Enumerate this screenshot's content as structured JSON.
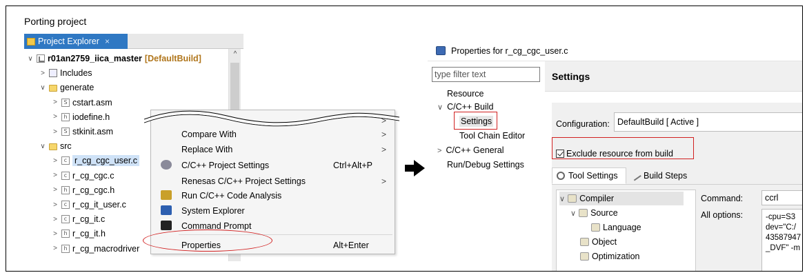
{
  "frame_title": "Porting project",
  "project_explorer": {
    "tab_label": "Project Explorer",
    "tab_close": "×",
    "tree": [
      {
        "label": "r01an2759_iica_master",
        "suffix": "[DefaultBuild]",
        "arrow": "∨",
        "icon": "project-icon",
        "indent": 0
      },
      {
        "label": "Includes",
        "arrow": ">",
        "icon": "includes-icon",
        "indent": 1
      },
      {
        "label": "generate",
        "arrow": "∨",
        "icon": "folder-icon",
        "indent": 1
      },
      {
        "label": "cstart.asm",
        "arrow": ">",
        "icon": "asm-file-icon",
        "indent": 2
      },
      {
        "label": "iodefine.h",
        "arrow": ">",
        "icon": "header-file-icon",
        "indent": 2
      },
      {
        "label": "stkinit.asm",
        "arrow": ">",
        "icon": "asm-file-icon",
        "indent": 2
      },
      {
        "label": "src",
        "arrow": "∨",
        "icon": "folder-icon",
        "indent": 1
      },
      {
        "label": "r_cg_cgc_user.c",
        "arrow": ">",
        "icon": "c-file-icon",
        "indent": 2,
        "selected": true
      },
      {
        "label": "r_cg_cgc.c",
        "arrow": ">",
        "icon": "c-file-icon",
        "indent": 2
      },
      {
        "label": "r_cg_cgc.h",
        "arrow": ">",
        "icon": "header-file-icon",
        "indent": 2
      },
      {
        "label": "r_cg_it_user.c",
        "arrow": ">",
        "icon": "c-file-icon",
        "indent": 2
      },
      {
        "label": "r_cg_it.c",
        "arrow": ">",
        "icon": "c-file-icon",
        "indent": 2
      },
      {
        "label": "r_cg_it.h",
        "arrow": ">",
        "icon": "header-file-icon",
        "indent": 2
      },
      {
        "label": "r_cg_macrodriver",
        "arrow": ">",
        "icon": "header-file-icon",
        "indent": 2
      }
    ],
    "scroll_up": "^"
  },
  "context_menu": {
    "items": [
      {
        "label": "",
        "submenu": ">",
        "icon": ""
      },
      {
        "label": "Compare With",
        "submenu": ">",
        "icon": ""
      },
      {
        "label": "Replace With",
        "submenu": ">",
        "icon": ""
      },
      {
        "label": "C/C++ Project Settings",
        "shortcut": "Ctrl+Alt+P",
        "icon": "project-settings-icon"
      },
      {
        "label": "Renesas C/C++ Project Settings",
        "submenu": ">",
        "icon": ""
      },
      {
        "label": "Run C/C++ Code Analysis",
        "icon": "code-analysis-icon"
      },
      {
        "label": "System Explorer",
        "icon": "system-explorer-icon"
      },
      {
        "label": "Command Prompt",
        "icon": "command-prompt-icon"
      },
      {
        "label": "Properties",
        "shortcut": "Alt+Enter",
        "icon": ""
      }
    ]
  },
  "properties_dialog": {
    "title": "Properties for r_cg_cgc_user.c",
    "filter_placeholder": "type filter text",
    "nav": [
      {
        "label": "Resource",
        "arrow": ""
      },
      {
        "label": "C/C++ Build",
        "arrow": "∨"
      },
      {
        "label": "Settings",
        "arrow": "",
        "child": true,
        "selected": true
      },
      {
        "label": "Tool Chain Editor",
        "arrow": "",
        "child": true
      },
      {
        "label": "C/C++ General",
        "arrow": ">"
      },
      {
        "label": "Run/Debug Settings",
        "arrow": ""
      }
    ],
    "heading": "Settings",
    "configuration_label": "Configuration:",
    "configuration_value": "DefaultBuild  [ Active ]",
    "exclude_label": "Exclude resource from build",
    "exclude_checked": true,
    "tabs": [
      {
        "label": "Tool Settings",
        "active": true
      },
      {
        "label": "Build Steps",
        "active": false
      }
    ],
    "tool_tree": [
      {
        "label": "Compiler",
        "arrow": "∨",
        "indent": 0,
        "highlight": true
      },
      {
        "label": "Source",
        "arrow": "∨",
        "indent": 1
      },
      {
        "label": "Language",
        "arrow": "",
        "indent": 2
      },
      {
        "label": "Object",
        "arrow": "",
        "indent": 1
      },
      {
        "label": "Optimization",
        "arrow": "",
        "indent": 1
      }
    ],
    "command_label": "Command:",
    "command_value": "ccrl",
    "all_options_label": "All options:",
    "all_options_lines": [
      "-cpu=S3",
      "dev=\"C:/",
      "43587947",
      "_DVF\"  -m"
    ]
  },
  "colors": {
    "accent_tab": "#2f78c3",
    "highlight_red": "#d11f1f",
    "default_build": "#b0761c"
  }
}
